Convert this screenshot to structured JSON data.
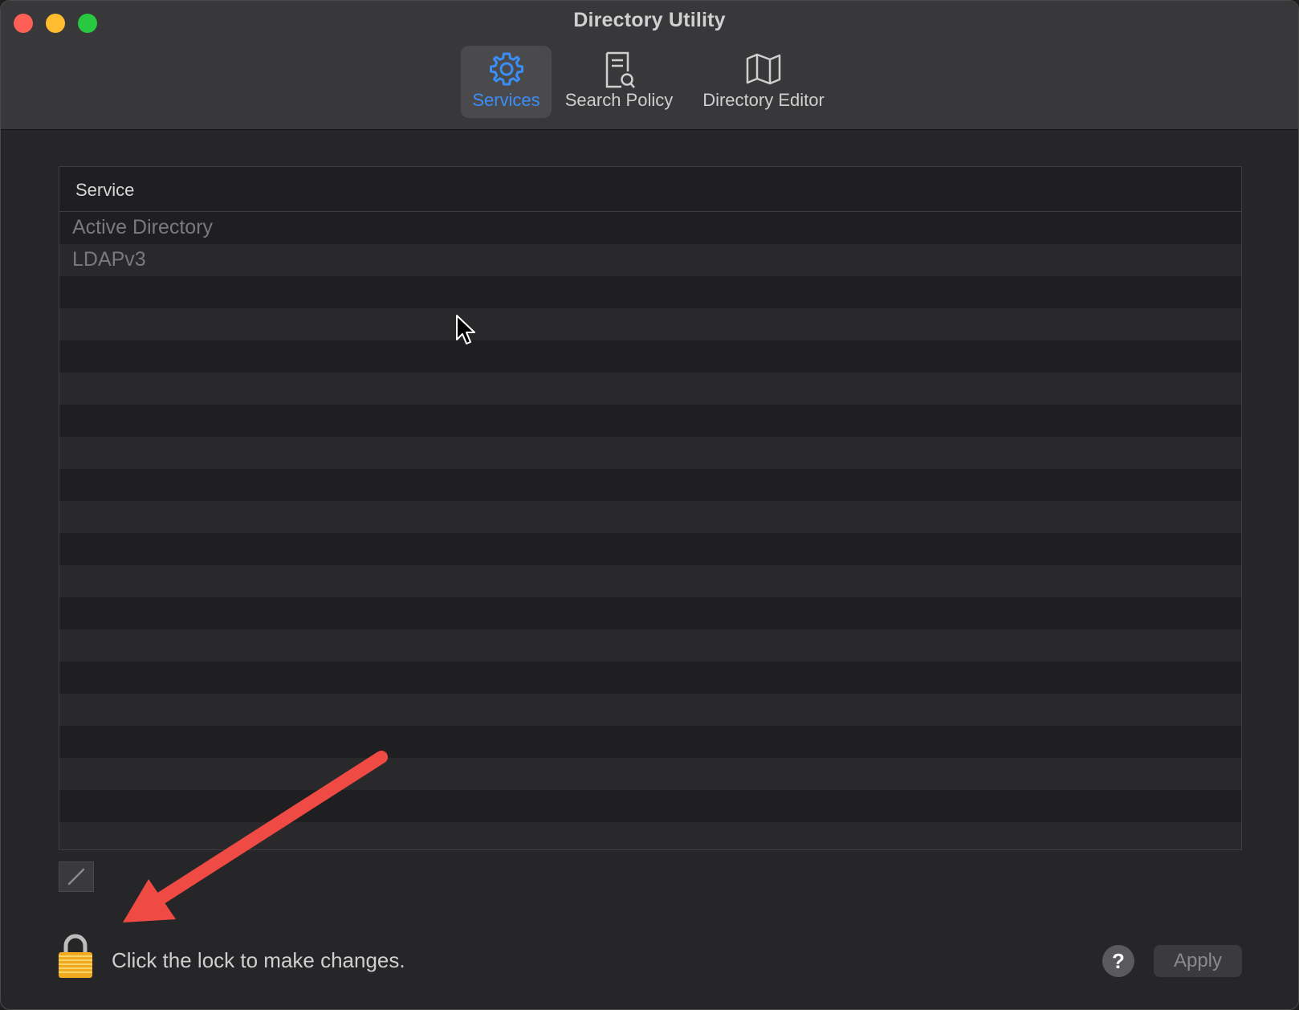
{
  "window": {
    "title": "Directory Utility"
  },
  "toolbar": {
    "items": [
      {
        "label": "Services",
        "icon": "gear-icon",
        "selected": true
      },
      {
        "label": "Search Policy",
        "icon": "document-search-icon",
        "selected": false
      },
      {
        "label": "Directory Editor",
        "icon": "map-icon",
        "selected": false
      }
    ]
  },
  "table": {
    "column_header": "Service",
    "rows": [
      "Active Directory",
      "LDAPv3"
    ]
  },
  "footer": {
    "lock_message": "Click the lock to make changes.",
    "help_label": "?",
    "apply_label": "Apply"
  },
  "colors": {
    "accent": "#3a8ef6",
    "annotation_arrow": "#f04a45",
    "close": "#fe5f57",
    "minimize": "#febc2e",
    "zoom": "#28c840"
  }
}
